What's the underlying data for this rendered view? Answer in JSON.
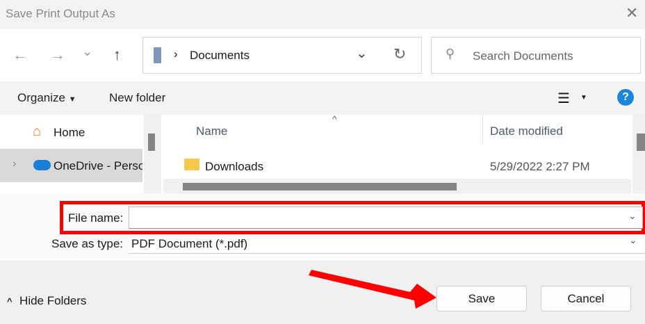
{
  "window": {
    "title": "Save Print Output As",
    "close": "✕"
  },
  "nav": {
    "back": "←",
    "forward": "→",
    "recent": "⌄",
    "up": "↑"
  },
  "address": {
    "separator": "›",
    "location": "Documents",
    "dropdown": "⌄",
    "refresh": "↻"
  },
  "search": {
    "placeholder": "Search Documents"
  },
  "toolbar": {
    "organize": "Organize",
    "new_folder": "New folder",
    "view": "☰",
    "help": "?"
  },
  "sidebar": {
    "items": [
      {
        "label": "Home"
      },
      {
        "label": "OneDrive - Perso"
      }
    ]
  },
  "list": {
    "columns": [
      "Name",
      "Date modified"
    ],
    "sort_indicator": "^",
    "rows": [
      {
        "name": "Downloads",
        "date": "5/29/2022 2:27 PM"
      }
    ]
  },
  "form": {
    "file_name_label": "File name:",
    "file_name_value": "",
    "save_type_label": "Save as type:",
    "save_type_value": "PDF Document (*.pdf)"
  },
  "footer": {
    "hide_folders": "Hide Folders",
    "save": "Save",
    "cancel": "Cancel"
  },
  "colors": {
    "annotation": "#ff0000",
    "help": "#1a86d9"
  }
}
